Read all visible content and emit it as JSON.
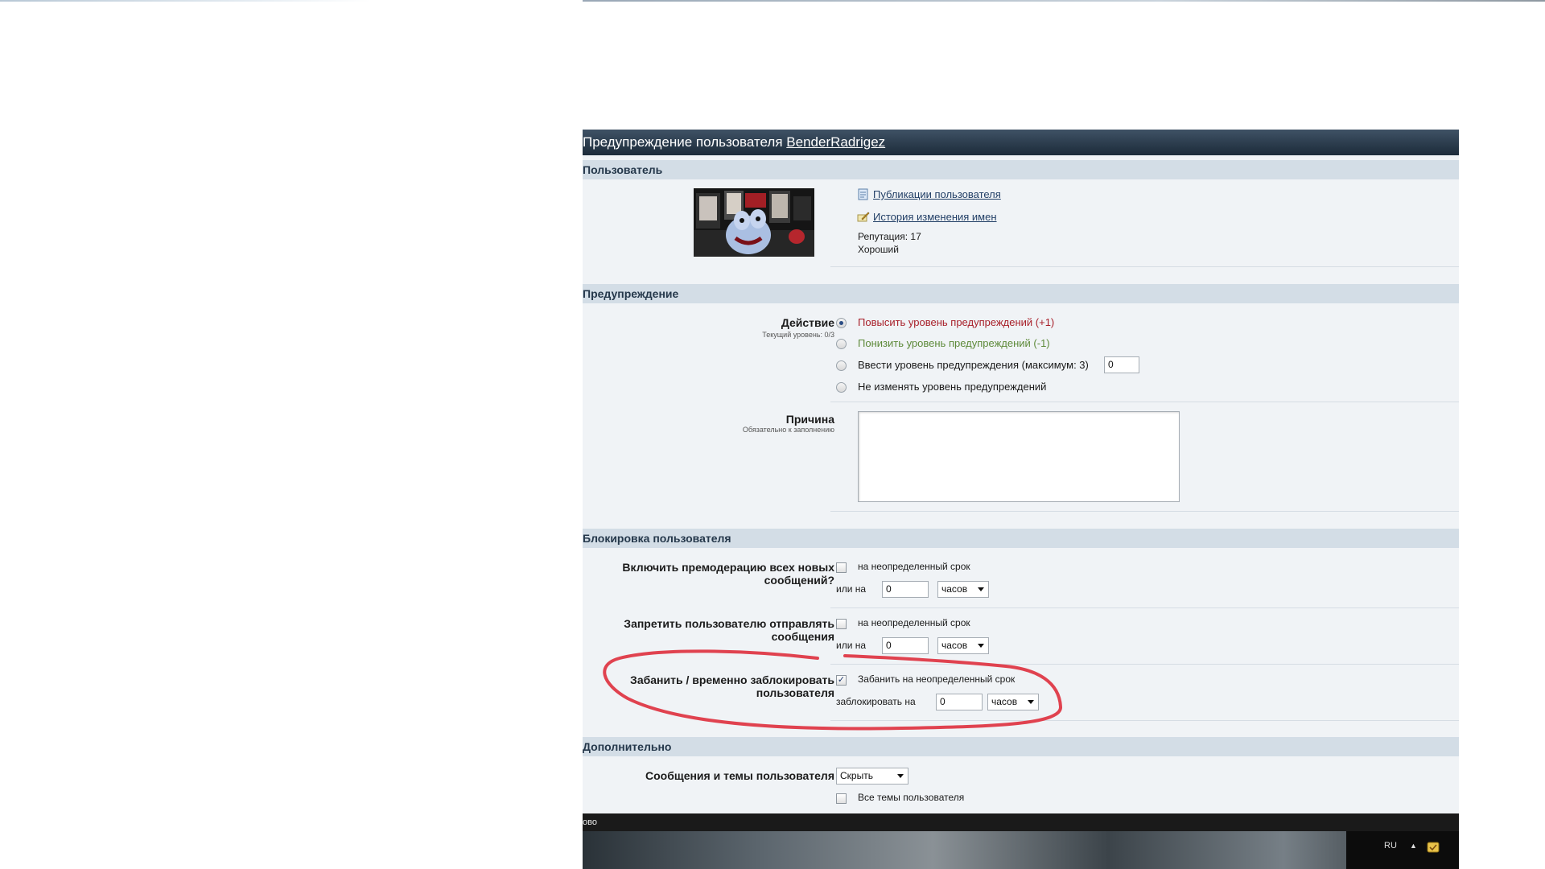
{
  "page": {
    "title_prefix": "Предупреждение пользователя",
    "username": "BenderRadrigez"
  },
  "user_section": {
    "heading": "Пользователь",
    "links": [
      {
        "label": "Публикации пользователя",
        "icon": "document-icon"
      },
      {
        "label": "История изменения имен",
        "icon": "pencil-icon"
      }
    ],
    "reputation": "Репутация: 17",
    "reputation_text": "Хороший"
  },
  "warning_section": {
    "heading": "Предупреждение",
    "action_label": "Действие",
    "action_sublabel": "Текущий уровень: 0/3",
    "options": [
      {
        "label": "Повысить уровень предупреждений (+1)",
        "checked": true,
        "color": "#a8202a"
      },
      {
        "label": "Понизить уровень предупреждений (-1)",
        "checked": false,
        "color": "#5e8a3a"
      },
      {
        "label": "Ввести уровень предупреждения (максимум: 3)",
        "checked": false,
        "color": "#1a1a1a"
      },
      {
        "label": "Не изменять уровень предупреждений",
        "checked": false,
        "color": "#1a1a1a"
      }
    ],
    "level_value": "0",
    "reason_label": "Причина",
    "reason_sublabel": "Обязательно к заполнению",
    "reason_value": ""
  },
  "block_section": {
    "heading": "Блокировка пользователя",
    "rows": [
      {
        "label_line1": "Включить премодерацию всех новых",
        "label_line2": "сообщений?",
        "checkbox_label": "на неопределенный срок",
        "checked": false,
        "or_label": "или на",
        "value": "0",
        "unit": "часов"
      },
      {
        "label_line1": "Запретить пользователю отправлять",
        "label_line2": "сообщения",
        "checkbox_label": "на неопределенный срок",
        "checked": false,
        "or_label": "или на",
        "value": "0",
        "unit": "часов"
      },
      {
        "label_line1": "Забанить / временно заблокировать",
        "label_line2": "пользователя",
        "checkbox_label": "Забанить на неопределенный срок",
        "checked": true,
        "or_label": "заблокировать на",
        "value": "0",
        "unit": "часов"
      }
    ]
  },
  "extra_section": {
    "heading": "Дополнительно",
    "posts_label": "Сообщения и темы пользователя",
    "posts_select": "Скрыть",
    "all_topics_label": "Все темы пользователя"
  },
  "bottom_bar": {
    "fragment": "ово"
  },
  "taskbar": {
    "language": "RU"
  },
  "colors": {
    "header_dark": "#1c2b3a",
    "section_bg": "#d3dde6",
    "panel_bg": "#f0f3f6",
    "annotation_red": "#e0424f"
  }
}
